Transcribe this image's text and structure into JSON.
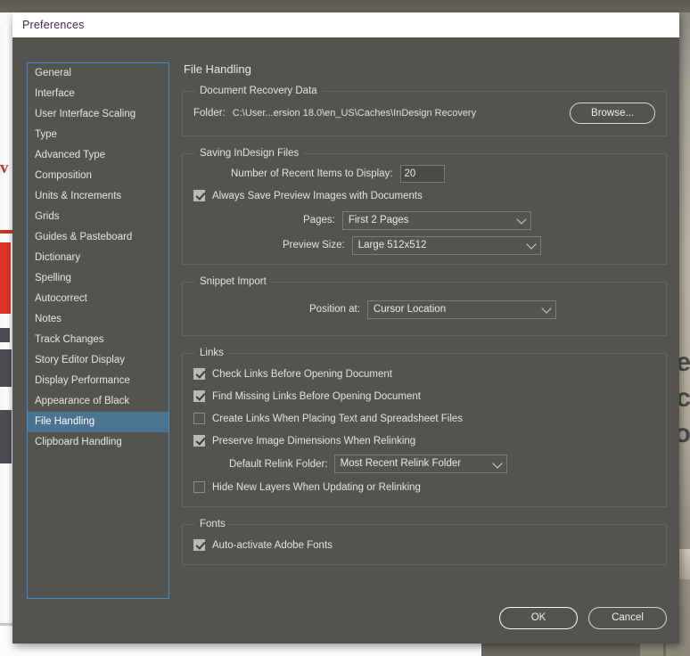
{
  "window": {
    "title": "Preferences"
  },
  "sidebar": {
    "items": [
      {
        "label": "General",
        "selected": false
      },
      {
        "label": "Interface",
        "selected": false
      },
      {
        "label": "User Interface Scaling",
        "selected": false
      },
      {
        "label": "Type",
        "selected": false
      },
      {
        "label": "Advanced Type",
        "selected": false
      },
      {
        "label": "Composition",
        "selected": false
      },
      {
        "label": "Units & Increments",
        "selected": false
      },
      {
        "label": "Grids",
        "selected": false
      },
      {
        "label": "Guides & Pasteboard",
        "selected": false
      },
      {
        "label": "Dictionary",
        "selected": false
      },
      {
        "label": "Spelling",
        "selected": false
      },
      {
        "label": "Autocorrect",
        "selected": false
      },
      {
        "label": "Notes",
        "selected": false
      },
      {
        "label": "Track Changes",
        "selected": false
      },
      {
        "label": "Story Editor Display",
        "selected": false
      },
      {
        "label": "Display Performance",
        "selected": false
      },
      {
        "label": "Appearance of Black",
        "selected": false
      },
      {
        "label": "File Handling",
        "selected": true
      },
      {
        "label": "Clipboard Handling",
        "selected": false
      }
    ]
  },
  "main": {
    "title": "File Handling",
    "recovery": {
      "legend": "Document Recovery Data",
      "folder_label": "Folder:",
      "folder_path": "C:\\User...ersion 18.0\\en_US\\Caches\\InDesign Recovery",
      "browse_label": "Browse..."
    },
    "saving": {
      "legend": "Saving InDesign Files",
      "recent_items_label": "Number of Recent Items to Display:",
      "recent_items_value": "20",
      "always_save_preview_label": "Always Save Preview Images with Documents",
      "always_save_preview_checked": true,
      "pages_label": "Pages:",
      "pages_value": "First 2 Pages",
      "preview_size_label": "Preview Size:",
      "preview_size_value": "Large 512x512"
    },
    "snippet": {
      "legend": "Snippet Import",
      "position_label": "Position at:",
      "position_value": "Cursor Location"
    },
    "links": {
      "legend": "Links",
      "options": [
        {
          "label": "Check Links Before Opening Document",
          "checked": true
        },
        {
          "label": "Find Missing Links Before Opening Document",
          "checked": true
        },
        {
          "label": "Create Links When Placing Text and Spreadsheet Files",
          "checked": false
        },
        {
          "label": "Preserve Image Dimensions When Relinking",
          "checked": true
        }
      ],
      "relink_folder_label": "Default Relink Folder:",
      "relink_folder_value": "Most Recent Relink Folder",
      "hide_new_layers_label": "Hide New Layers When Updating or Relinking",
      "hide_new_layers_checked": false
    },
    "fonts": {
      "legend": "Fonts",
      "auto_activate_label": "Auto-activate Adobe Fonts",
      "auto_activate_checked": true
    }
  },
  "footer": {
    "ok_label": "OK",
    "cancel_label": "Cancel"
  },
  "backdrop": {
    "red_text": "v f",
    "photo_text_lines": [
      "re",
      "ec",
      "ro"
    ]
  },
  "colors": {
    "dialog_bg": "#54534f",
    "titlebar_bg": "#ffffff",
    "title_text": "#3b2a4a",
    "selection": "#4b7491",
    "sidebar_border": "#3f8fd0",
    "group_border": "#666461",
    "text": "#e4e4e4",
    "accent_red": "#dc3223"
  }
}
